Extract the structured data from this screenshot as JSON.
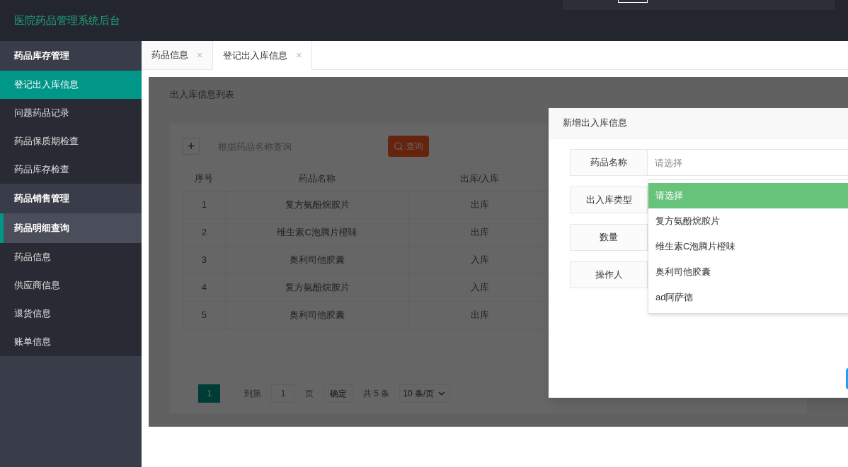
{
  "header": {
    "title": "医院药品管理系统后台"
  },
  "sidebar": {
    "groups": [
      {
        "label": "药品库存管理",
        "hovered": false,
        "children": [
          {
            "label": "登记出入库信息",
            "selected": true
          },
          {
            "label": "问题药品记录",
            "selected": false
          },
          {
            "label": "药品保质期检查",
            "selected": false
          },
          {
            "label": "药品库存检查",
            "selected": false
          }
        ]
      },
      {
        "label": "药品销售管理",
        "hovered": false
      },
      {
        "label": "药品明细查询",
        "hovered": true,
        "children": [
          {
            "label": "药品信息",
            "selected": false
          },
          {
            "label": "供应商信息",
            "selected": false
          },
          {
            "label": "退货信息",
            "selected": false
          },
          {
            "label": "账单信息",
            "selected": false
          }
        ]
      }
    ]
  },
  "tabs": [
    {
      "label": "药品信息",
      "close": "×",
      "selected": false
    },
    {
      "label": "登记出入库信息",
      "close": "×",
      "selected": true
    }
  ],
  "list": {
    "title": "出入库信息列表",
    "add": "+",
    "search": {
      "placeholder": "根据药品名称查询"
    },
    "search_button": "查询",
    "table": {
      "columns": [
        "序号",
        "药品名称",
        "出库/入库"
      ],
      "rows": [
        [
          "1",
          "复方氨酚烷胺片",
          "出库"
        ],
        [
          "2",
          "维生素C泡腾片橙味",
          "出库"
        ],
        [
          "3",
          "奥利司他胶囊",
          "入库"
        ],
        [
          "4",
          "复方氨酚烷胺片",
          "入库"
        ],
        [
          "5",
          "奥利司他胶囊",
          "出库"
        ]
      ]
    },
    "pagination": {
      "pages": [
        {
          "label": "1",
          "selected": true
        }
      ],
      "goto_label": "到第",
      "goto_value": "1",
      "page_unit": "页",
      "confirm": "确定",
      "total": "共 5 条",
      "page_size": "10 条/页"
    }
  },
  "dialog": {
    "title": "新增出入库信息",
    "fields": [
      {
        "label": "药品名称",
        "placeholder": "请选择"
      },
      {
        "label": "出入库类型"
      },
      {
        "label": "数量"
      },
      {
        "label": "操作人"
      }
    ],
    "dropdown": {
      "options": [
        {
          "label": "请选择",
          "selected": true
        },
        {
          "label": "复方氨酚烷胺片",
          "selected": false
        },
        {
          "label": "维生素C泡腾片橙味",
          "selected": false
        },
        {
          "label": "奥利司他胶囊",
          "selected": false
        },
        {
          "label": "ad阿萨德",
          "selected": false
        }
      ]
    }
  }
}
